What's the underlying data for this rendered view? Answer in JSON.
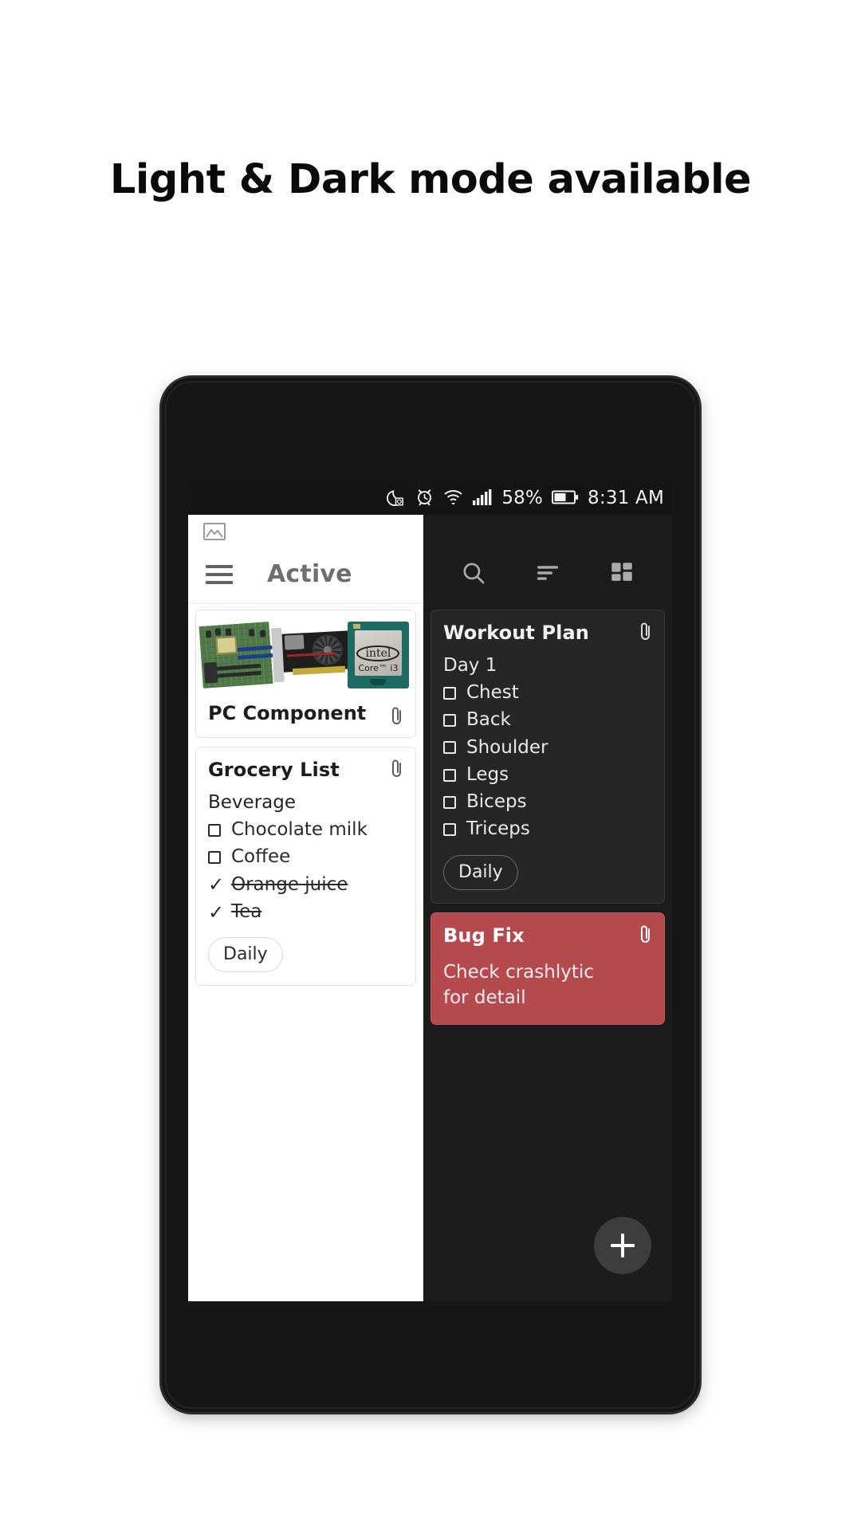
{
  "headline": "Light & Dark mode available",
  "status_bar": {
    "icons": [
      "dnd-moon-icon",
      "alarm-icon",
      "wifi-icon",
      "signal-icon"
    ],
    "battery_percent": "58%",
    "battery_icon": "battery-icon",
    "time": "8:31 AM"
  },
  "light_pane": {
    "image_icon": "image-placeholder-icon",
    "menu_icon": "hamburger-menu-icon",
    "title": "Active",
    "cards": [
      {
        "id": "pc-component",
        "title": "PC Component",
        "attachment_icon": "paperclip-icon",
        "images": [
          "motherboard",
          "graphics-card",
          "intel-core-i3-cpu"
        ],
        "cpu_brand": "intel",
        "cpu_model": "Core™ i3"
      },
      {
        "id": "grocery-list",
        "title": "Grocery List",
        "attachment_icon": "paperclip-icon",
        "section_label": "Beverage",
        "items": [
          {
            "text": "Chocolate milk",
            "checked": false
          },
          {
            "text": "Coffee",
            "checked": false
          },
          {
            "text": "Orange juice",
            "checked": true
          },
          {
            "text": "Tea",
            "checked": true
          }
        ],
        "chip": "Daily"
      }
    ]
  },
  "dark_pane": {
    "toolbar": {
      "search_icon": "search-icon",
      "sort_icon": "sort-icon",
      "layout_icon": "grid-layout-icon"
    },
    "cards": [
      {
        "id": "workout-plan",
        "title": "Workout Plan",
        "attachment_icon": "paperclip-icon",
        "section_label": "Day 1",
        "items": [
          {
            "text": "Chest",
            "checked": false
          },
          {
            "text": "Back",
            "checked": false
          },
          {
            "text": "Shoulder",
            "checked": false
          },
          {
            "text": "Legs",
            "checked": false
          },
          {
            "text": "Biceps",
            "checked": false
          },
          {
            "text": "Triceps",
            "checked": false
          }
        ],
        "chip": "Daily"
      },
      {
        "id": "bug-fix",
        "title": "Bug Fix",
        "attachment_icon": "paperclip-icon",
        "body_line_1": "Check crashlytic",
        "body_line_2": "for detail",
        "color": "#b44a4e"
      }
    ],
    "fab": {
      "icon": "plus-icon",
      "label": "+"
    }
  },
  "colors": {
    "page_background": "#ffffff",
    "headline": "#0a0a0a",
    "phone_body": "#161616",
    "dark_surface": "#1c1c1c",
    "dark_card": "#262626",
    "light_card": "#ffffff",
    "accent_red": "#b44a4e",
    "fab": "#3d3d3d"
  }
}
